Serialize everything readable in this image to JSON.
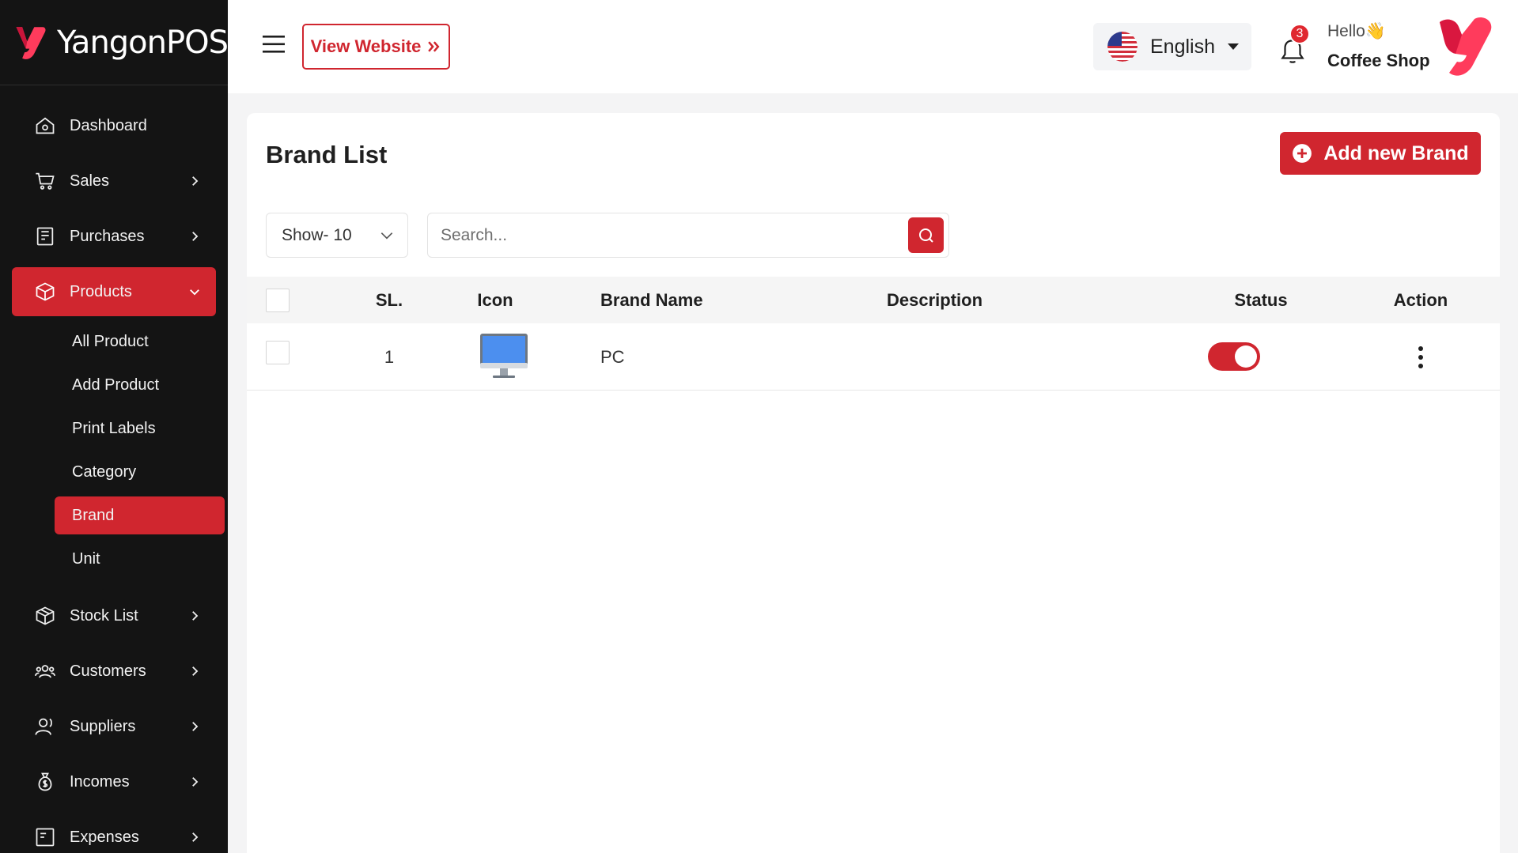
{
  "brand": {
    "name": "YangonPOS",
    "accent": "#d0262f"
  },
  "sidebar": {
    "items": [
      {
        "label": "Dashboard",
        "icon": "home-icon"
      },
      {
        "label": "Sales",
        "icon": "cart-icon"
      },
      {
        "label": "Purchases",
        "icon": "receipt-icon"
      },
      {
        "label": "Products",
        "icon": "box-icon"
      },
      {
        "label": "Stock List",
        "icon": "package-icon"
      },
      {
        "label": "Customers",
        "icon": "users-icon"
      },
      {
        "label": "Suppliers",
        "icon": "supplier-icon"
      },
      {
        "label": "Incomes",
        "icon": "money-bag-icon"
      },
      {
        "label": "Expenses",
        "icon": "expense-icon"
      }
    ],
    "products_sub": [
      {
        "label": "All Product"
      },
      {
        "label": "Add Product"
      },
      {
        "label": "Print Labels"
      },
      {
        "label": "Category"
      },
      {
        "label": "Brand"
      },
      {
        "label": "Unit"
      }
    ]
  },
  "header": {
    "view_website": "View Website",
    "language": "English",
    "notifications": "3",
    "greeting": "Hello👋",
    "user": "Coffee Shop"
  },
  "page": {
    "title": "Brand List",
    "add_button": "Add new Brand",
    "show_select": "Show- 10",
    "search_placeholder": "Search..."
  },
  "table": {
    "columns": [
      "SL.",
      "Icon",
      "Brand Name",
      "Description",
      "Status",
      "Action"
    ],
    "rows": [
      {
        "sl": "1",
        "icon": "monitor-icon",
        "brand_name": "PC",
        "description": "",
        "status": true
      }
    ]
  }
}
